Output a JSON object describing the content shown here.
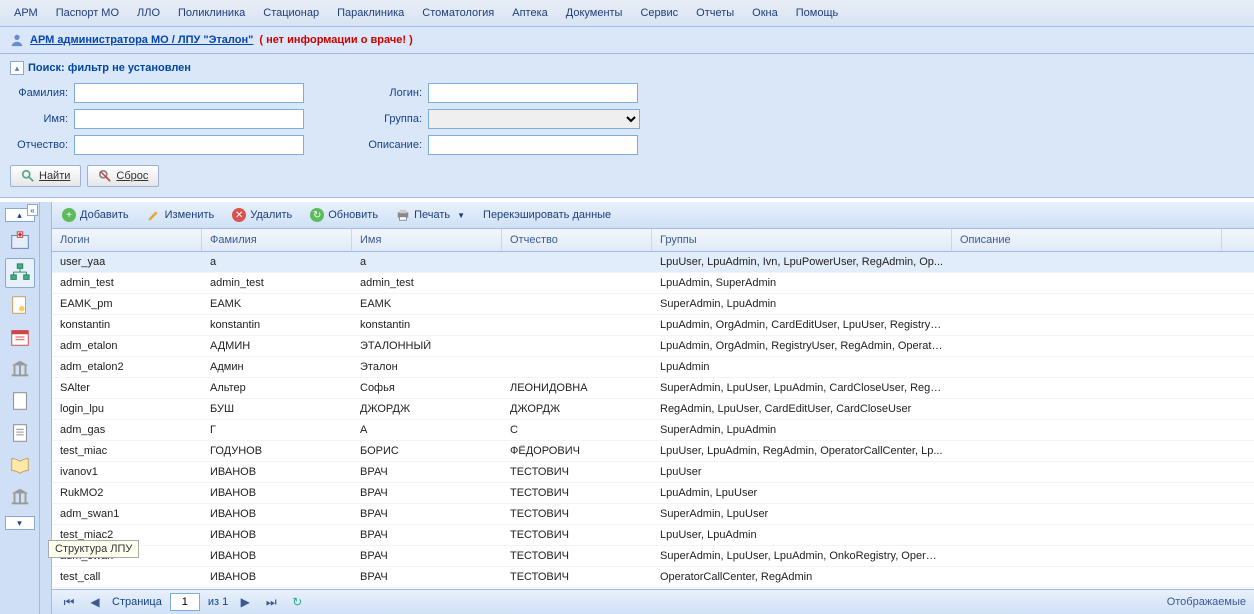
{
  "menu": [
    "АРМ",
    "Паспорт МО",
    "ЛЛО",
    "Поликлиника",
    "Стационар",
    "Параклиника",
    "Стоматология",
    "Аптека",
    "Документы",
    "Сервис",
    "Отчеты",
    "Окна",
    "Помощь"
  ],
  "context": {
    "link": "АРМ администратора МО / ЛПУ \"Эталон\"",
    "warn": "( нет информации о враче! )"
  },
  "search": {
    "title": "Поиск: фильтр не установлен",
    "lbl_fam": "Фамилия:",
    "lbl_name": "Имя:",
    "lbl_otch": "Отчество:",
    "lbl_login": "Логин:",
    "lbl_group": "Группа:",
    "lbl_desc": "Описание:",
    "btn_find": "Найти",
    "btn_reset": "Сброс",
    "val_fam": "",
    "val_name": "",
    "val_otch": "",
    "val_login": "",
    "val_group": "",
    "val_desc": ""
  },
  "sidebar": {
    "tooltip": "Структура ЛПУ",
    "icons": [
      "hospital",
      "org-tree",
      "book-user",
      "calendar",
      "bank",
      "page",
      "doc",
      "open-book",
      "bank2"
    ]
  },
  "toolbar": {
    "add": "Добавить",
    "edit": "Изменить",
    "delete": "Удалить",
    "refresh": "Обновить",
    "print": "Печать",
    "recache": "Перекэшировать данные"
  },
  "columns": {
    "login": "Логин",
    "fam": "Фамилия",
    "name": "Имя",
    "otch": "Отчество",
    "groups": "Группы",
    "desc": "Описание"
  },
  "rows": [
    {
      "login": "user_yaa",
      "fam": "a",
      "name": "a",
      "otch": "",
      "groups": "LpuUser, LpuAdmin, Ivn, LpuPowerUser, RegAdmin, Op...",
      "desc": "",
      "selected": true
    },
    {
      "login": "admin_test",
      "fam": "admin_test",
      "name": "admin_test",
      "otch": "",
      "groups": "LpuAdmin, SuperAdmin",
      "desc": ""
    },
    {
      "login": "EAMK_pm",
      "fam": "EAMK",
      "name": "EAMK",
      "otch": "",
      "groups": "SuperAdmin, LpuAdmin",
      "desc": ""
    },
    {
      "login": "konstantin",
      "fam": "konstantin",
      "name": "konstantin",
      "otch": "",
      "groups": "LpuAdmin, OrgAdmin, CardEditUser, LpuUser, RegistryU...",
      "desc": ""
    },
    {
      "login": "adm_etalon",
      "fam": "АДМИН",
      "name": "ЭТАЛОННЫЙ",
      "otch": "",
      "groups": "LpuAdmin, OrgAdmin, RegistryUser, RegAdmin, Operato...",
      "desc": ""
    },
    {
      "login": "adm_etalon2",
      "fam": "Админ",
      "name": "Эталон",
      "otch": "",
      "groups": "LpuAdmin",
      "desc": ""
    },
    {
      "login": "SAlter",
      "fam": "Альтер",
      "name": "Софья",
      "otch": "ЛЕОНИДОВНА",
      "groups": "SuperAdmin, LpuUser, LpuAdmin, CardCloseUser, RegA...",
      "desc": ""
    },
    {
      "login": "login_lpu",
      "fam": "БУШ",
      "name": "ДЖОРДЖ",
      "otch": "ДЖОРДЖ",
      "groups": "RegAdmin, LpuUser, CardEditUser, CardCloseUser",
      "desc": ""
    },
    {
      "login": "adm_gas",
      "fam": "Г",
      "name": "А",
      "otch": "С",
      "groups": "SuperAdmin, LpuAdmin",
      "desc": ""
    },
    {
      "login": "test_miac",
      "fam": "ГОДУНОВ",
      "name": "БОРИС",
      "otch": "ФЁДОРОВИЧ",
      "groups": "LpuUser, LpuAdmin, RegAdmin, OperatorCallCenter, Lp...",
      "desc": ""
    },
    {
      "login": "ivanov1",
      "fam": "ИВАНОВ",
      "name": "ВРАЧ",
      "otch": "ТЕСТОВИЧ",
      "groups": "LpuUser",
      "desc": ""
    },
    {
      "login": "RukMO2",
      "fam": "ИВАНОВ",
      "name": "ВРАЧ",
      "otch": "ТЕСТОВИЧ",
      "groups": "LpuAdmin, LpuUser",
      "desc": ""
    },
    {
      "login": "adm_swan1",
      "fam": "ИВАНОВ",
      "name": "ВРАЧ",
      "otch": "ТЕСТОВИЧ",
      "groups": "SuperAdmin, LpuUser",
      "desc": ""
    },
    {
      "login": "test_miac2",
      "fam": "ИВАНОВ",
      "name": "ВРАЧ",
      "otch": "ТЕСТОВИЧ",
      "groups": "LpuUser, LpuAdmin",
      "desc": ""
    },
    {
      "login": "adm_swan",
      "fam": "ИВАНОВ",
      "name": "ВРАЧ",
      "otch": "ТЕСТОВИЧ",
      "groups": "SuperAdmin, LpuUser, LpuAdmin, OnkoRegistry, OperPr...",
      "desc": ""
    },
    {
      "login": "test_call",
      "fam": "ИВАНОВ",
      "name": "ВРАЧ",
      "otch": "ТЕСТОВИЧ",
      "groups": "OperatorCallCenter, RegAdmin",
      "desc": ""
    }
  ],
  "pager": {
    "page_lbl": "Страница",
    "page": "1",
    "of": "из 1",
    "status": "Отображаемые"
  }
}
